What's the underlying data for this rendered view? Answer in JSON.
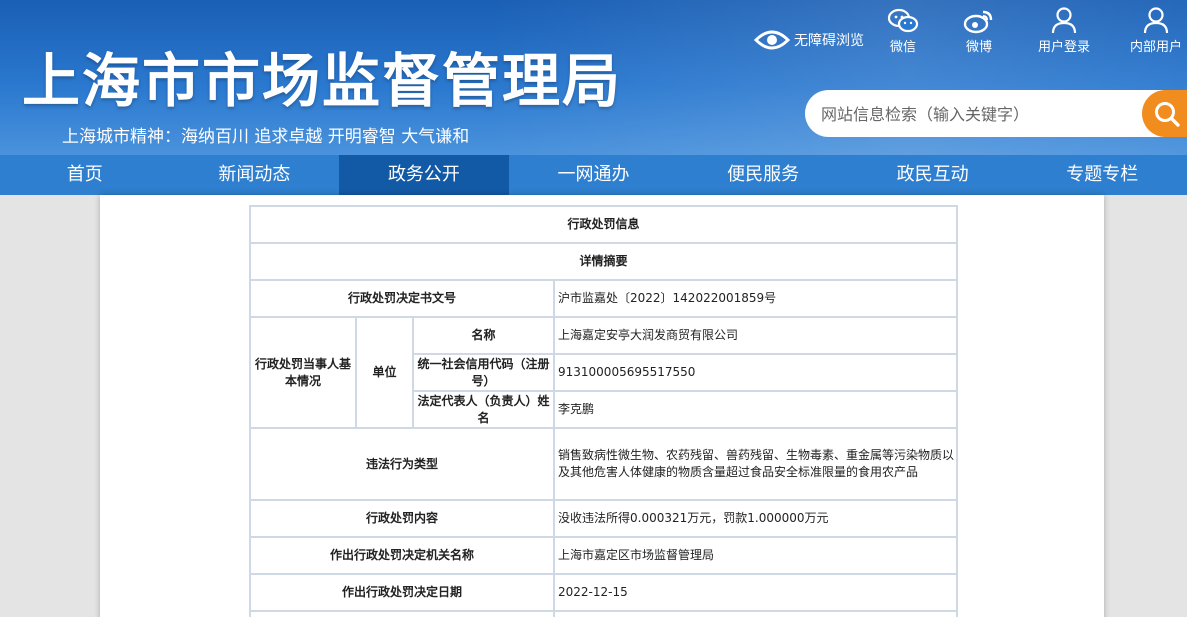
{
  "header": {
    "title": "上海市市场监督管理局",
    "slogan": "上海城市精神：海纳百川    追求卓越    开明睿智    大气谦和",
    "accessibility": "无障碍浏览",
    "tools": [
      {
        "label": "微信",
        "icon": "wechat-icon"
      },
      {
        "label": "微博",
        "icon": "weibo-icon"
      },
      {
        "label": "用户登录",
        "icon": "user-icon"
      },
      {
        "label": "内部用户",
        "icon": "user-icon"
      }
    ],
    "search_placeholder": "网站信息检索（输入关键字）"
  },
  "nav": {
    "items": [
      "首页",
      "新闻动态",
      "政务公开",
      "一网通办",
      "便民服务",
      "政民互动",
      "专题专栏"
    ],
    "active": "政务公开"
  },
  "table": {
    "title": "行政处罚信息",
    "summary": "详情摘要",
    "doc_no_label": "行政处罚决定书文号",
    "doc_no": "沪市监嘉处〔2022〕142022001859号",
    "party_label": "行政处罚当事人基本情况",
    "unit_label": "单位",
    "name_label": "名称",
    "name": "上海嘉定安亭大润发商贸有限公司",
    "credit_label": "统一社会信用代码（注册号）",
    "credit": "913100005695517550",
    "rep_label": "法定代表人（负责人）姓名",
    "rep": "李克鹏",
    "violation_label": "违法行为类型",
    "violation": "销售致病性微生物、农药残留、兽药残留、生物毒素、重金属等污染物质以及其他危害人体健康的物质含量超过食品安全标准限量的食用农产品",
    "content_label": "行政处罚内容",
    "content": "没收违法所得0.000321万元，罚款1.000000万元",
    "authority_label": "作出行政处罚决定机关名称",
    "authority": "上海市嘉定区市场监督管理局",
    "date_label": "作出行政处罚决定日期",
    "date": "2022-12-15"
  },
  "colors": {
    "header_blue": "#2a78cf",
    "nav_blue": "#2e7fcf",
    "nav_active": "#1259a6",
    "search_orange": "#f08d1e"
  }
}
